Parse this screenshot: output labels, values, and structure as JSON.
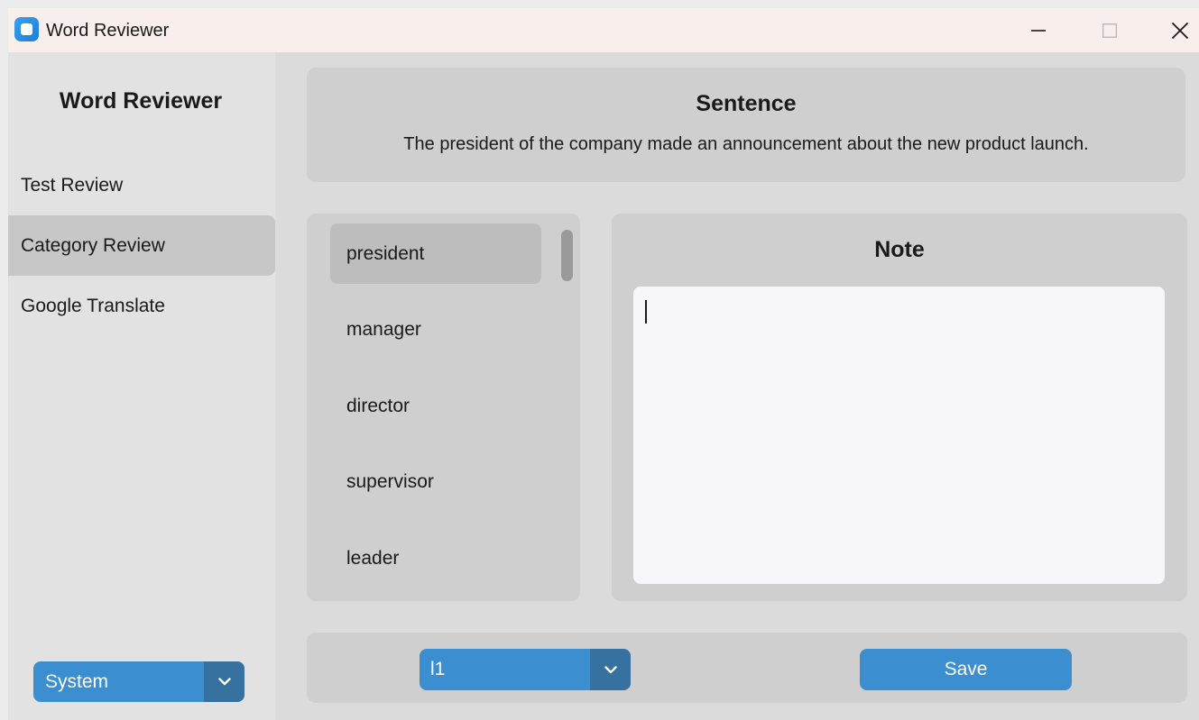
{
  "window": {
    "title": "Word Reviewer"
  },
  "sidebar": {
    "title": "Word Reviewer",
    "items": [
      {
        "label": "Test Review",
        "active": false
      },
      {
        "label": "Category Review",
        "active": true
      },
      {
        "label": "Google Translate",
        "active": false
      }
    ],
    "appearance_mode": "System"
  },
  "sentence": {
    "title": "Sentence",
    "text": "The president of the company made an announcement about the new product launch."
  },
  "words": {
    "items": [
      "president",
      "manager",
      "director",
      "supervisor",
      "leader"
    ],
    "selected": "president"
  },
  "note": {
    "title": "Note",
    "value": ""
  },
  "controls": {
    "category": "l1",
    "save_label": "Save"
  },
  "colors": {
    "accent": "#3b8ed0",
    "accent_dark": "#36719f",
    "panel": "#cfcfcf",
    "selected": "#bdbdbd"
  },
  "icons": {
    "app": "app-icon",
    "minimize": "minimize-icon",
    "maximize": "maximize-icon",
    "close": "close-icon",
    "dropdown": "chevron-down-icon"
  }
}
